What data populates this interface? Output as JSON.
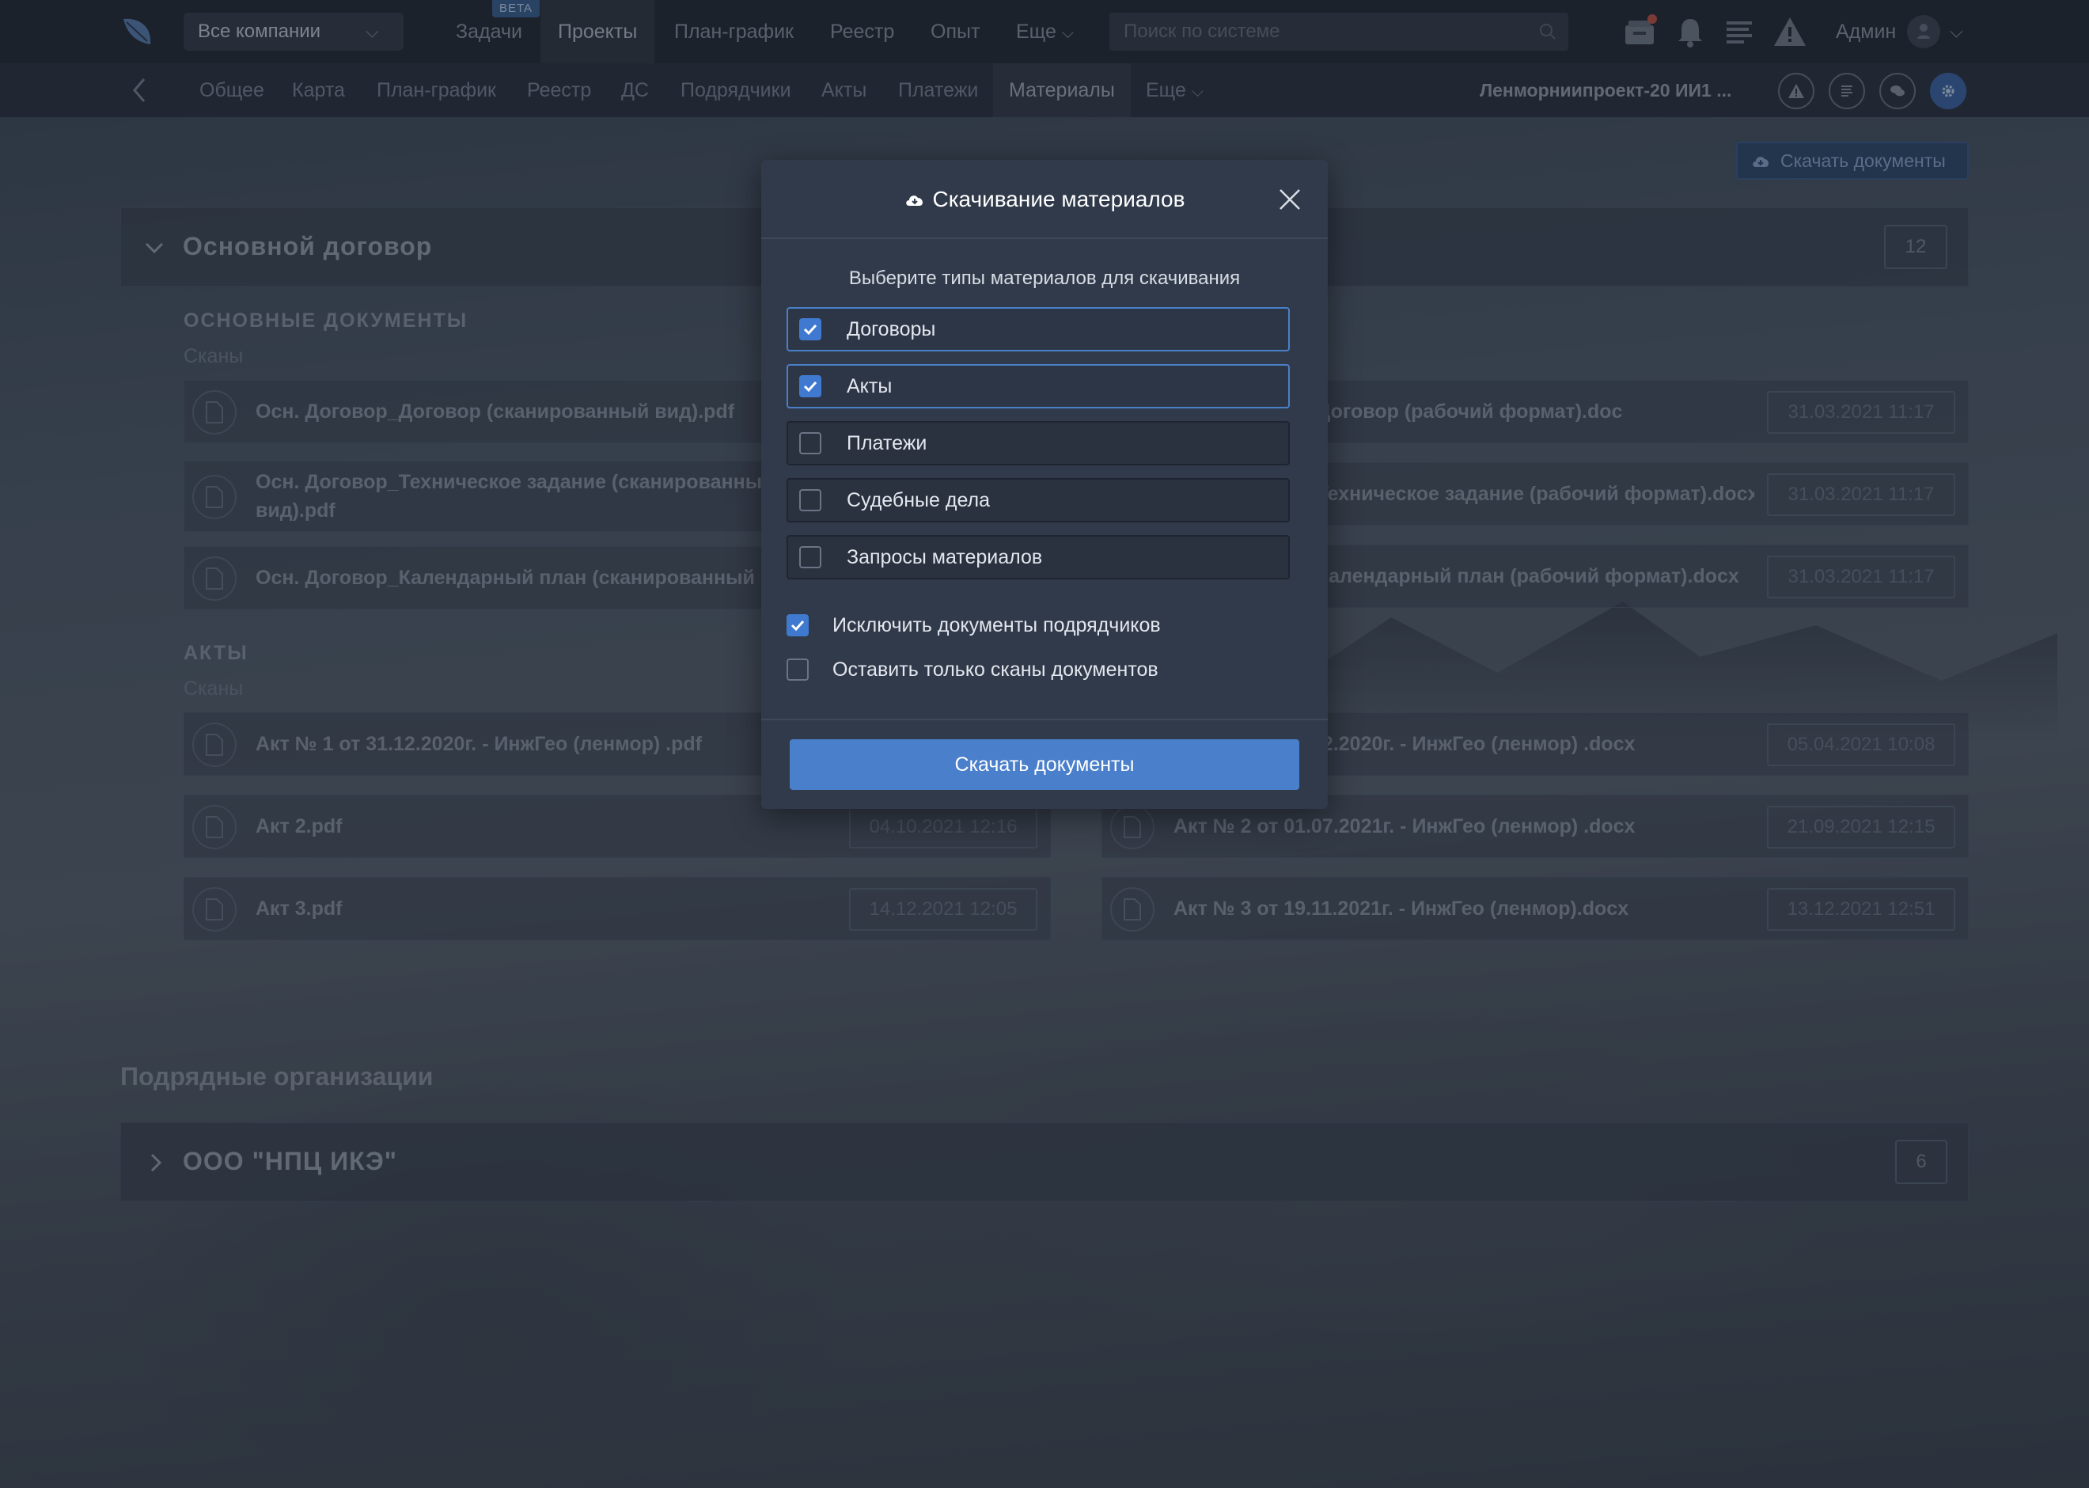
{
  "topbar": {
    "company_select": "Все компании",
    "nav": [
      {
        "label": "Задачи"
      },
      {
        "label": "Проекты"
      },
      {
        "label": "План-график"
      },
      {
        "label": "Реестр"
      },
      {
        "label": "Опыт"
      },
      {
        "label": "Еще"
      }
    ],
    "beta_badge": "BETA",
    "search_placeholder": "Поиск по системе",
    "user_name": "Админ"
  },
  "subnav": {
    "tabs": [
      {
        "label": "Общее"
      },
      {
        "label": "Карта"
      },
      {
        "label": "План-график"
      },
      {
        "label": "Реестр"
      },
      {
        "label": "ДС"
      },
      {
        "label": "Подрядчики"
      },
      {
        "label": "Акты"
      },
      {
        "label": "Платежи"
      },
      {
        "label": "Материалы"
      },
      {
        "label": "Еще"
      }
    ],
    "active_tab": "Материалы",
    "project_name": "Ленморниипроект-20 ИИ1 ..."
  },
  "main": {
    "download_button": "Скачать документы",
    "contract": {
      "title": "Основной договор",
      "count": "12",
      "sections": [
        {
          "title": "ОСНОВНЫЕ ДОКУМЕНТЫ",
          "subtitle": "Сканы",
          "left": [
            {
              "name": "Осн. Договор_Договор (сканированный вид).pdf",
              "date": ""
            },
            {
              "name": "Осн. Договор_Техническое задание (сканированный вид).pdf",
              "date": ""
            },
            {
              "name": "Осн. Договор_Календарный план (сканированный вид).pdf",
              "date": ""
            }
          ],
          "right": [
            {
              "name": "Осн. Договор_Договор (рабочий формат).doc",
              "date": "31.03.2021 11:17"
            },
            {
              "name": "Осн. Договор_Техническое задание (рабочий формат).docx",
              "date": "31.03.2021 11:17"
            },
            {
              "name": "Осн. Договор_Календарный план (рабочий формат).docx",
              "date": "31.03.2021 11:17"
            }
          ]
        },
        {
          "title": "АКТЫ",
          "subtitle": "Сканы",
          "left": [
            {
              "name": "Акт № 1 от 31.12.2020г. - ИнжГео (ленмор) .pdf",
              "date": ""
            },
            {
              "name": "Акт 2.pdf",
              "date": "04.10.2021 12:16"
            },
            {
              "name": "Акт 3.pdf",
              "date": "14.12.2021 12:05"
            }
          ],
          "right": [
            {
              "name": "Акт № 1 от 31.12.2020г. - ИнжГео (ленмор) .docx",
              "date": "05.04.2021 10:08"
            },
            {
              "name": "Акт № 2 от 01.07.2021г. - ИнжГео (ленмор) .docx",
              "date": "21.09.2021 12:15"
            },
            {
              "name": "Акт № 3 от 19.11.2021г. - ИнжГео (ленмор).docx",
              "date": "13.12.2021 12:51"
            }
          ]
        }
      ]
    },
    "subcontractors_title": "Подрядные организации",
    "subcontractor": {
      "name": "ООО \"НПЦ ИКЭ\"",
      "count": "6"
    }
  },
  "modal": {
    "title": "Скачивание материалов",
    "lead": "Выберите типы материалов для скачивания",
    "types": [
      {
        "label": "Договоры",
        "checked": true
      },
      {
        "label": "Акты",
        "checked": true
      },
      {
        "label": "Платежи",
        "checked": false
      },
      {
        "label": "Судебные дела",
        "checked": false
      },
      {
        "label": "Запросы материалов",
        "checked": false
      }
    ],
    "exclude_contractors": {
      "label": "Исключить документы подрядчиков",
      "checked": true
    },
    "scans_only": {
      "label": "Оставить только сканы документов",
      "checked": false
    },
    "submit": "Скачать документы"
  }
}
